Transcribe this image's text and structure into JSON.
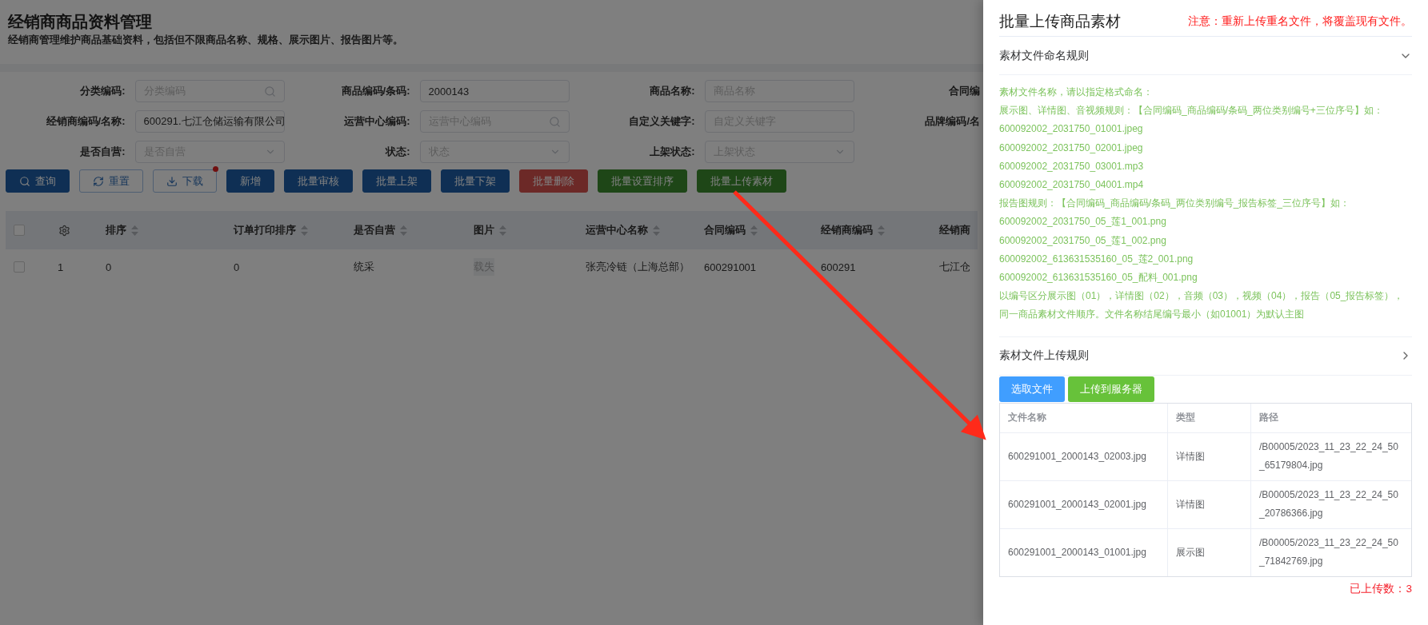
{
  "page": {
    "title": "经销商商品资料管理",
    "subtitle": "经销商管理维护商品基础资料，包括但不限商品名称、规格、展示图片、报告图片等。"
  },
  "filters": [
    {
      "label": "分类编码:",
      "kind": "search",
      "placeholder": "分类编码"
    },
    {
      "label": "商品编码/条码:",
      "kind": "text",
      "value": "2000143"
    },
    {
      "label": "商品名称:",
      "kind": "text",
      "placeholder": "商品名称"
    },
    {
      "label": "合同编",
      "kind": "label"
    },
    {
      "label": "经销商编码/名称:",
      "kind": "search",
      "value": "600291.七江仓储运输有限公司"
    },
    {
      "label": "运营中心编码:",
      "kind": "search",
      "placeholder": "运营中心编码"
    },
    {
      "label": "自定义关键字:",
      "kind": "text",
      "placeholder": "自定义关键字"
    },
    {
      "label": "品牌编码/名",
      "kind": "label"
    },
    {
      "label": "是否自营:",
      "kind": "select",
      "placeholder": "是否自营"
    },
    {
      "label": "状态:",
      "kind": "select",
      "placeholder": "状态"
    },
    {
      "label": "上架状态:",
      "kind": "select",
      "placeholder": "上架状态"
    }
  ],
  "actions": [
    {
      "label": "查询",
      "kind": "primary"
    },
    {
      "label": "重置",
      "kind": "default"
    },
    {
      "label": "下载",
      "kind": "default",
      "dot": true
    },
    {
      "label": "新增",
      "kind": "primary"
    },
    {
      "label": "批量审核",
      "kind": "primary"
    },
    {
      "label": "批量上架",
      "kind": "primary"
    },
    {
      "label": "批量下架",
      "kind": "primary"
    },
    {
      "label": "批量删除",
      "kind": "danger"
    },
    {
      "label": "批量设置排序",
      "kind": "success"
    },
    {
      "label": "批量上传素材",
      "kind": "success"
    }
  ],
  "table": {
    "header_checked": false,
    "columns": [
      {
        "label": "排序"
      },
      {
        "label": "订单打印排序"
      },
      {
        "label": "是否自营"
      },
      {
        "label": "图片"
      },
      {
        "label": "运营中心名称"
      },
      {
        "label": "合同编码"
      },
      {
        "label": "经销商编码"
      },
      {
        "label": "经销商"
      }
    ],
    "rows": [
      {
        "checked": false,
        "index": "1",
        "cells": [
          "0",
          "0",
          "统采",
          "载失",
          "张亮冷链（上海总部）",
          "600291001",
          "600291",
          "七江仓"
        ]
      }
    ]
  },
  "drawer": {
    "title": "批量上传商品素材",
    "notice": "注意：重新上传重名文件，将覆盖现有文件。",
    "sections": [
      {
        "title": "素材文件命名规则",
        "expanded": true,
        "lines": [
          "素材文件名称，请以指定格式命名：",
          "展示图、详情图、音视频规则：【合同编码_商品编码/条码_两位类别编号+三位序号】如：",
          "600092002_2031750_01001.jpeg",
          "600092002_2031750_02001.jpeg",
          "600092002_2031750_03001.mp3",
          "600092002_2031750_04001.mp4",
          "报告图规则：【合同编码_商品编码/条码_两位类别编号_报告标签_三位序号】如：",
          "600092002_2031750_05_莲1_001.png",
          "600092002_2031750_05_莲1_002.png",
          "600092002_613631535160_05_莲2_001.png",
          "600092002_613631535160_05_配料_001.png",
          "以编号区分展示图（01），详情图（02），音频（03），视频（04），报告（05_报告标签），",
          "同一商品素材文件顺序。文件名称结尾编号最小（如01001）为默认主图"
        ]
      },
      {
        "title": "素材文件上传规则",
        "expanded": false
      }
    ],
    "buttons": [
      {
        "label": "选取文件",
        "kind": "primary"
      },
      {
        "label": "上传到服务器",
        "kind": "success"
      }
    ],
    "files": {
      "columns": [
        "文件名称",
        "类型",
        "路径"
      ],
      "rows": [
        [
          "600291001_2000143_02003.jpg",
          "详情图",
          "/B00005/2023_11_23_22_24_50_65179804.jpg"
        ],
        [
          "600291001_2000143_02001.jpg",
          "详情图",
          "/B00005/2023_11_23_22_24_50_20786366.jpg"
        ],
        [
          "600291001_2000143_01001.jpg",
          "展示图",
          "/B00005/2023_11_23_22_24_50_71842769.jpg"
        ]
      ]
    },
    "count": "已上传数：3"
  }
}
